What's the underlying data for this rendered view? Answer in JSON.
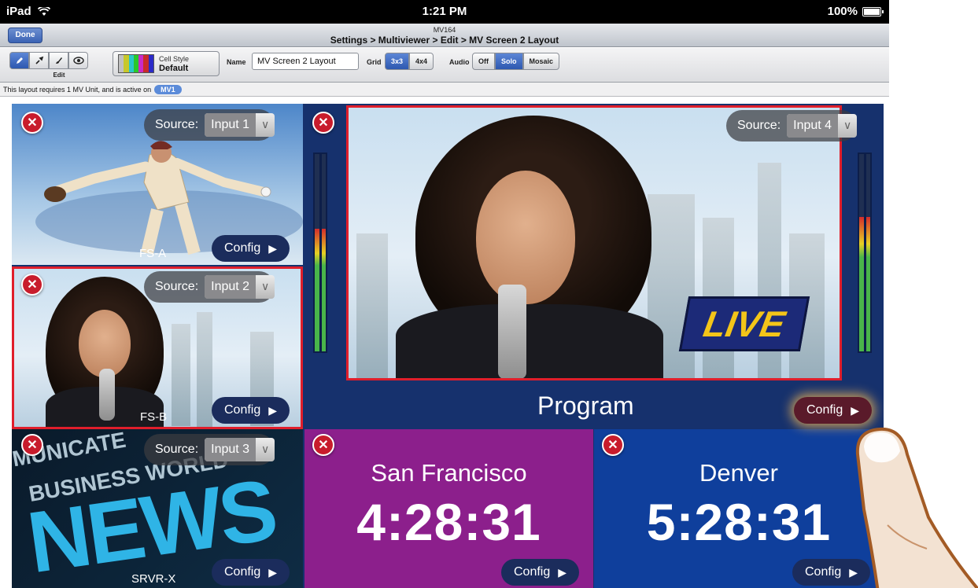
{
  "status_bar": {
    "device": "iPad",
    "time": "1:21 PM",
    "battery": "100%"
  },
  "nav": {
    "done_label": "Done",
    "subtitle": "MV164",
    "title": "Settings > Multiviewer > Edit > MV Screen 2 Layout"
  },
  "toolbar": {
    "edit_label": "Edit",
    "tools": [
      "pencil-icon",
      "eyedropper-icon",
      "brush-icon",
      "eye-icon"
    ],
    "cell_style_label": "Cell Style",
    "cell_style_value": "Default",
    "name_label": "Name",
    "name_value": "MV Screen 2 Layout",
    "grid_label": "Grid",
    "grid_options": [
      "3x3",
      "4x4"
    ],
    "grid_selected": "3x3",
    "audio_label": "Audio",
    "audio_options": [
      "Off",
      "Solo",
      "Mosaic"
    ],
    "audio_selected": "Solo"
  },
  "info": {
    "text": "This layout requires 1 MV Unit, and is active on",
    "badge": "MV1"
  },
  "cells": {
    "fs_a": {
      "source_label": "Source:",
      "source_value": "Input 1",
      "label": "FS-A",
      "config_label": "Config"
    },
    "fs_b": {
      "source_label": "Source:",
      "source_value": "Input 2",
      "label": "FS-B",
      "config_label": "Config"
    },
    "srvr_x": {
      "source_label": "Source:",
      "source_value": "Input 3",
      "label": "SRVR-X",
      "config_label": "Config",
      "art_big": "NEWS",
      "art_small_1": "MUNICATE",
      "art_small_2": "BUSINESS WORLD"
    },
    "program": {
      "source_label": "Source:",
      "source_value": "Input 4",
      "label": "Program",
      "config_label": "Config",
      "live_label": "LIVE"
    },
    "san_francisco": {
      "city": "San Francisco",
      "time": "4:28:31",
      "config_label": "Config"
    },
    "denver": {
      "city": "Denver",
      "time": "5:28:31",
      "config_label": "Config"
    }
  },
  "colors": {
    "accent": "#3a62b4",
    "selected_border": "#e01e2b",
    "sf_bg": "#8c1f8c",
    "denver_bg": "#0f3f9c",
    "mv_bg": "#16316d",
    "live_text": "#f3c519"
  },
  "meters": {
    "left_level": 0.62,
    "right_level": 0.68
  }
}
